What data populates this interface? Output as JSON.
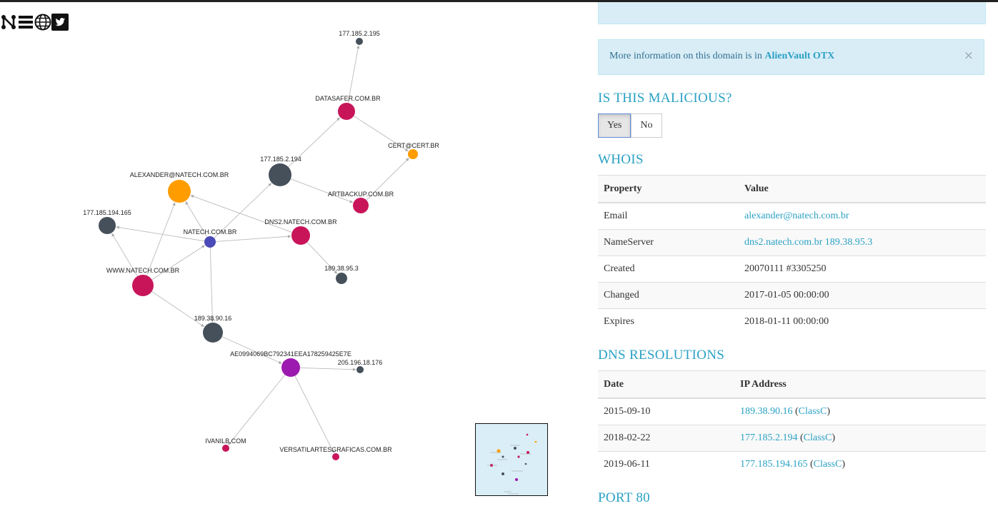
{
  "toolbar": {
    "icons": [
      "neo-logo-icon",
      "list-icon",
      "globe-icon",
      "twitter-icon"
    ]
  },
  "graph": {
    "nodes": [
      {
        "id": "n1",
        "label": "177.185.2.195",
        "type": "ip",
        "color": "#46505a"
      },
      {
        "id": "n2",
        "label": "DATASAFER.COM.BR",
        "type": "domain",
        "color": "#c8155a"
      },
      {
        "id": "n3",
        "label": "CERT@CERT.BR",
        "type": "email",
        "color": "#ff9c00"
      },
      {
        "id": "n4",
        "label": "177.185.2.194",
        "type": "ip",
        "color": "#46505a"
      },
      {
        "id": "n5",
        "label": "ALEXANDER@NATECH.COM.BR",
        "type": "email",
        "color": "#ff9c00"
      },
      {
        "id": "n6",
        "label": "ARTBACKUP.COM.BR",
        "type": "domain",
        "color": "#c8155a"
      },
      {
        "id": "n7",
        "label": "177.185.194.165",
        "type": "ip",
        "color": "#46505a"
      },
      {
        "id": "n8",
        "label": "NATECH.COM.BR",
        "type": "root",
        "color": "#4a4ab8"
      },
      {
        "id": "n9",
        "label": "DNS2.NATECH.COM.BR",
        "type": "domain",
        "color": "#c8155a"
      },
      {
        "id": "n10",
        "label": "189.38.95.3",
        "type": "ip",
        "color": "#46505a"
      },
      {
        "id": "n11",
        "label": "WWW.NATECH.COM.BR",
        "type": "domain",
        "color": "#c8155a"
      },
      {
        "id": "n12",
        "label": "189.38.90.16",
        "type": "ip",
        "color": "#46505a"
      },
      {
        "id": "n13",
        "label": "AE0994069BC792341EEA178259425E7E",
        "type": "hash",
        "color": "#9c1ab0"
      },
      {
        "id": "n14",
        "label": "205.196.18.176",
        "type": "ip",
        "color": "#46505a"
      },
      {
        "id": "n15",
        "label": "IVANILB.COM",
        "type": "domain",
        "color": "#c8155a"
      },
      {
        "id": "n16",
        "label": "VERSATILARTESGRAFICAS.COM.BR",
        "type": "domain",
        "color": "#c8155a"
      }
    ],
    "edges": [
      [
        "n2",
        "n1"
      ],
      [
        "n2",
        "n3"
      ],
      [
        "n4",
        "n2"
      ],
      [
        "n6",
        "n3"
      ],
      [
        "n4",
        "n6"
      ],
      [
        "n8",
        "n4"
      ],
      [
        "n8",
        "n5"
      ],
      [
        "n8",
        "n7"
      ],
      [
        "n8",
        "n9"
      ],
      [
        "n9",
        "n10"
      ],
      [
        "n8",
        "n12"
      ],
      [
        "n11",
        "n8"
      ],
      [
        "n11",
        "n7"
      ],
      [
        "n11",
        "n5"
      ],
      [
        "n9",
        "n5"
      ],
      [
        "n11",
        "n12"
      ],
      [
        "n12",
        "n13"
      ],
      [
        "n13",
        "n14"
      ],
      [
        "n13",
        "n15"
      ],
      [
        "n13",
        "n16"
      ]
    ]
  },
  "alert": {
    "text": "More information on this domain is in ",
    "link": "AlienVault OTX",
    "close": "×"
  },
  "malicious": {
    "heading": "IS THIS MALICIOUS?",
    "yes": "Yes",
    "no": "No",
    "selected": "Yes"
  },
  "whois": {
    "heading": "WHOIS",
    "columns": [
      "Property",
      "Value"
    ],
    "rows": [
      {
        "property": "Email",
        "value": "alexander@natech.com.br",
        "link": true
      },
      {
        "property": "NameServer",
        "value": "dns2.natech.com.br 189.38.95.3",
        "link": true
      },
      {
        "property": "Created",
        "value": "20070111 #3305250",
        "link": false
      },
      {
        "property": "Changed",
        "value": "2017-01-05 00:00:00",
        "link": false
      },
      {
        "property": "Expires",
        "value": "2018-01-11 00:00:00",
        "link": false
      }
    ]
  },
  "dns": {
    "heading": "DNS RESOLUTIONS",
    "columns": [
      "Date",
      "IP Address"
    ],
    "rows": [
      {
        "date": "2015-09-10",
        "ip": "189.38.90.16",
        "class": "ClassC"
      },
      {
        "date": "2018-02-22",
        "ip": "177.185.2.194",
        "class": "ClassC"
      },
      {
        "date": "2019-06-11",
        "ip": "177.185.194.165",
        "class": "ClassC"
      }
    ]
  },
  "port": {
    "heading": "PORT 80"
  },
  "colors": {
    "accent": "#2aa1c4",
    "alert_bg": "#d9edf7",
    "domain": "#c8155a",
    "ip": "#46505a",
    "email": "#ff9c00",
    "hash": "#9c1ab0",
    "root": "#4a4ab8"
  }
}
